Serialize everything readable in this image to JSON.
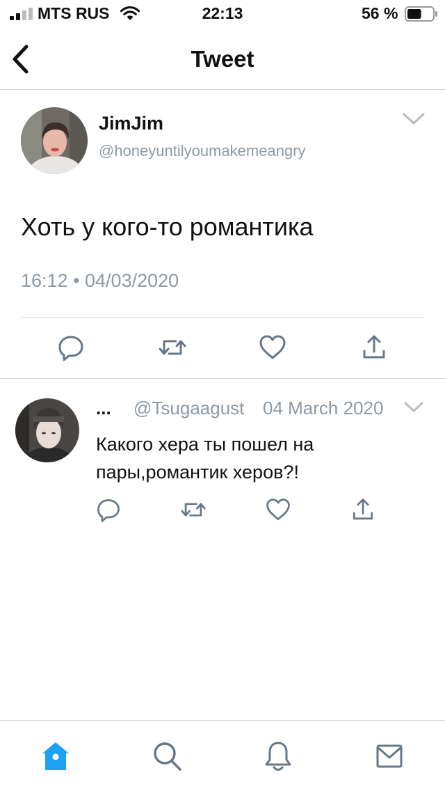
{
  "status_bar": {
    "carrier": "MTS RUS",
    "time": "22:13",
    "battery_percent": "56 %",
    "battery_level": 0.56
  },
  "header": {
    "title": "Tweet"
  },
  "main_tweet": {
    "author_name": "JimJim",
    "author_handle": "@honeyuntilyoumakemeangry",
    "text": "Хоть у кого-то романтика",
    "timestamp": "16:12 • 04/03/2020"
  },
  "reply": {
    "author_name": "...",
    "author_handle": "@Tsugaagust",
    "date": "04 March 2020",
    "text": "Какого хера ты пошел на пары,романтик херов?!"
  },
  "tab_bar": {
    "tabs": [
      "home",
      "search",
      "notifications",
      "messages"
    ],
    "active_tab": "home"
  },
  "colors": {
    "accent": "#1da1f2",
    "icon_gray": "#657786",
    "muted_text": "#8d99a5",
    "divider": "#cfd4d8"
  },
  "icons": {
    "back": "chevron-left-icon",
    "caret": "chevron-down-icon",
    "reply": "reply-icon",
    "retweet": "retweet-icon",
    "like": "heart-icon",
    "share": "share-icon",
    "home": "home-icon",
    "search": "search-icon",
    "notifications": "bell-icon",
    "messages": "mail-icon"
  }
}
